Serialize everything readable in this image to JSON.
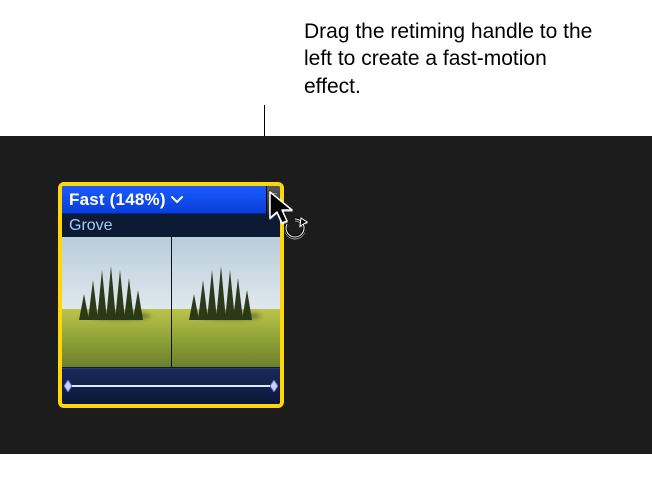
{
  "annotation": {
    "text": "Drag the retiming handle to the left to create a fast-motion effect."
  },
  "clip": {
    "retime_label": "Fast (148%)",
    "name": "Grove"
  },
  "icons": {
    "dropdown_caret": "⌄"
  }
}
